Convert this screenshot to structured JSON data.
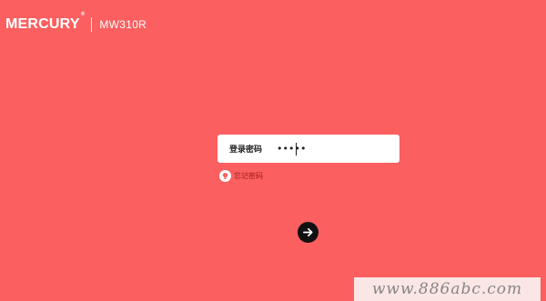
{
  "header": {
    "brand": "MERCURY",
    "trademark": "®",
    "model": "MW310R"
  },
  "login": {
    "password_label": "登录密码",
    "password_value": "•••••",
    "forgot_label": "忘记密码"
  },
  "icons": {
    "forgot": "bulb-icon",
    "submit": "arrow-right-icon"
  },
  "colors": {
    "background": "#fb5f5f",
    "panel": "#ffffff",
    "button": "#111111",
    "forgot_text": "#a01818"
  },
  "watermark": {
    "text": "www.886abc.com"
  }
}
